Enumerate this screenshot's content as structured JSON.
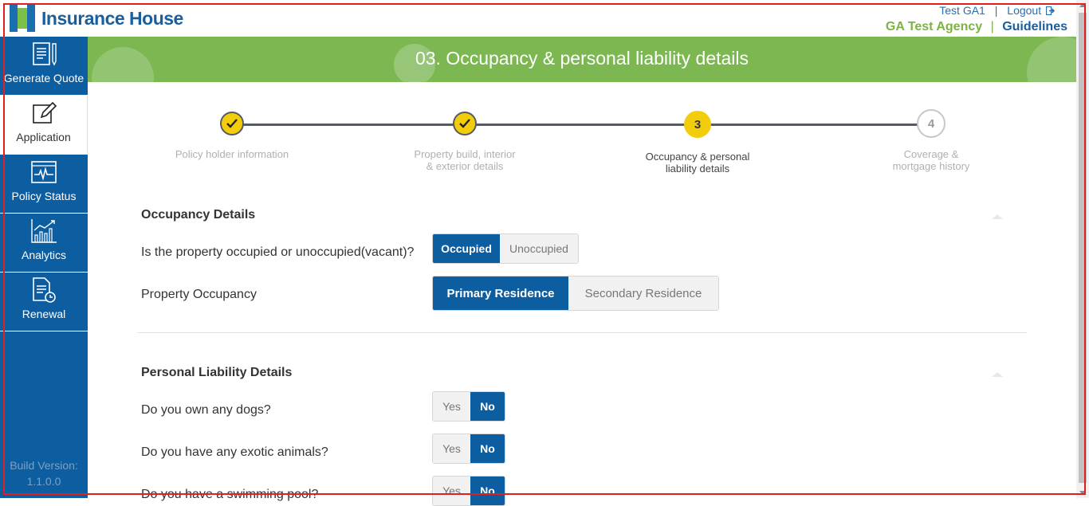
{
  "header": {
    "brand": "Insurance House",
    "user": "Test GA1",
    "divider": "|",
    "logout": "Logout",
    "agency": "GA Test Agency",
    "guidelines": "Guidelines"
  },
  "sidebar": {
    "items": [
      {
        "label": "Generate Quote",
        "icon": "quote-document-icon"
      },
      {
        "label": "Application",
        "icon": "edit-icon"
      },
      {
        "label": "Policy Status",
        "icon": "pulse-monitor-icon"
      },
      {
        "label": "Analytics",
        "icon": "bar-chart-icon"
      },
      {
        "label": "Renewal",
        "icon": "renewal-document-icon"
      }
    ],
    "build_label": "Build Version:",
    "build_version": "1.1.0.0"
  },
  "banner": {
    "title": "03. Occupancy & personal liability details"
  },
  "stepper": {
    "steps": [
      {
        "number": "1",
        "status": "done",
        "line1": "Policy holder information",
        "line2": ""
      },
      {
        "number": "2",
        "status": "done",
        "line1": "Property build, interior",
        "line2": "& exterior details"
      },
      {
        "number": "3",
        "status": "current",
        "line1": "Occupancy & personal",
        "line2": "liability details"
      },
      {
        "number": "4",
        "status": "upcoming",
        "line1": "Coverage &",
        "line2": "mortgage history"
      }
    ]
  },
  "occupancy": {
    "title": "Occupancy Details",
    "q1": "Is the property occupied or unoccupied(vacant)?",
    "q1_opt_a": "Occupied",
    "q1_opt_b": "Unoccupied",
    "q1_selected": "Occupied",
    "q2": "Property Occupancy",
    "q2_opt_a": "Primary Residence",
    "q2_opt_b": "Secondary Residence",
    "q2_selected": "Primary Residence"
  },
  "liability": {
    "title": "Personal Liability Details",
    "q1": "Do you own any dogs?",
    "q2": "Do you have any exotic animals?",
    "q3": "Do you have a swimming pool?",
    "yes": "Yes",
    "no": "No",
    "q1_selected": "No",
    "q2_selected": "No",
    "q3_selected": "No"
  },
  "colors": {
    "primary": "#0d5ea0",
    "accent_green": "#7cb752",
    "step_yellow": "#f4cd0a"
  }
}
